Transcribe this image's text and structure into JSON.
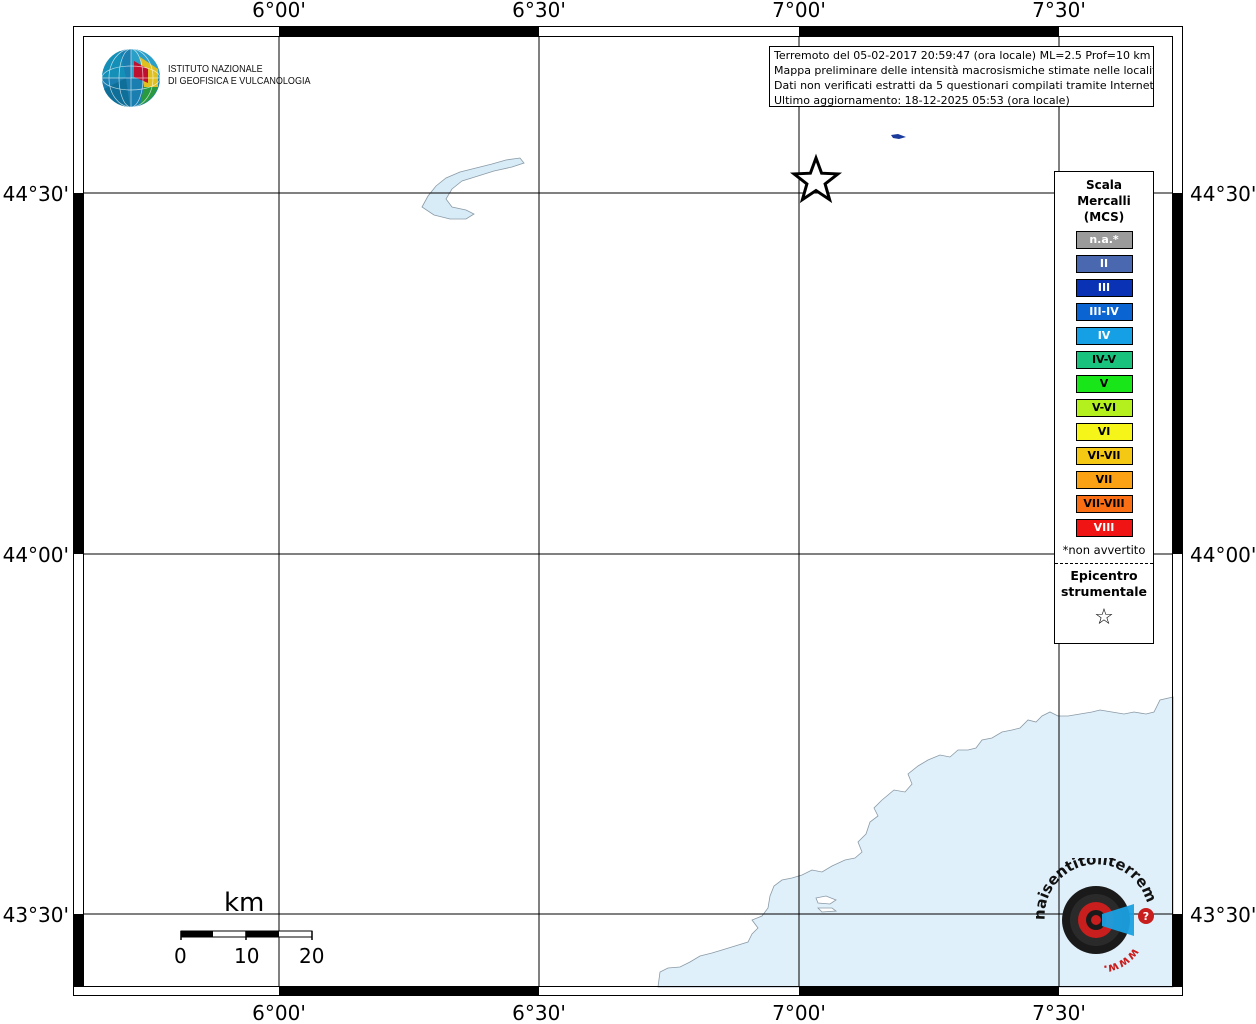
{
  "map": {
    "lon_labels": [
      "6°00'",
      "6°30'",
      "7°00'",
      "7°30'"
    ],
    "lat_labels": [
      "44°30'",
      "44°00'",
      "43°30'"
    ]
  },
  "info": {
    "line1": "Terremoto del 05-02-2017 20:59:47 (ora locale) ML=2.5 Prof=10 km",
    "line2": "Mappa preliminare delle intensità macrosismiche stimate nelle località",
    "line3": "Dati non verificati estratti da 5 questionari compilati tramite Internet.",
    "line4": "Ultimo aggiornamento: 18-12-2025 05:53 (ora locale)"
  },
  "legend": {
    "title1": "Scala",
    "title2": "Mercalli",
    "title3": "(MCS)",
    "items": [
      {
        "label": "n.a.*",
        "color": "#9b9b9b",
        "text_color": "#ffffff"
      },
      {
        "label": "II",
        "color": "#4a68b0",
        "text_color": "#ffffff"
      },
      {
        "label": "III",
        "color": "#0a32b4",
        "text_color": "#ffffff"
      },
      {
        "label": "III-IV",
        "color": "#0a64d2",
        "text_color": "#ffffff"
      },
      {
        "label": "IV",
        "color": "#15a0e6",
        "text_color": "#ffffff"
      },
      {
        "label": "IV-V",
        "color": "#19c37d",
        "text_color": "#000000"
      },
      {
        "label": "V",
        "color": "#19e619",
        "text_color": "#000000"
      },
      {
        "label": "V-VI",
        "color": "#b4f01e",
        "text_color": "#000000"
      },
      {
        "label": "VI",
        "color": "#f5f519",
        "text_color": "#000000"
      },
      {
        "label": "VI-VII",
        "color": "#f5c814",
        "text_color": "#000000"
      },
      {
        "label": "VII",
        "color": "#fba214",
        "text_color": "#000000"
      },
      {
        "label": "VII-VIII",
        "color": "#fa6e14",
        "text_color": "#000000"
      },
      {
        "label": "VIII",
        "color": "#f01414",
        "text_color": "#ffffff"
      }
    ],
    "note": "*non avvertito",
    "epicentro1": "Epicentro",
    "epicentro2": "strumentale",
    "star": "☆"
  },
  "ingv": {
    "line1": "ISTITUTO NAZIONALE",
    "line2": "DI GEOFISICA E VULCANOLOGIA"
  },
  "scalebar": {
    "unit": "km",
    "labels": [
      "0",
      "10",
      "20"
    ]
  },
  "hsit": {
    "text": "haisentitoilterremoto.it",
    "www": "www."
  },
  "colors": {
    "water": "#e0f0fa",
    "lake": "#d8ecf8",
    "coast_stroke": "#8a9aa6"
  }
}
